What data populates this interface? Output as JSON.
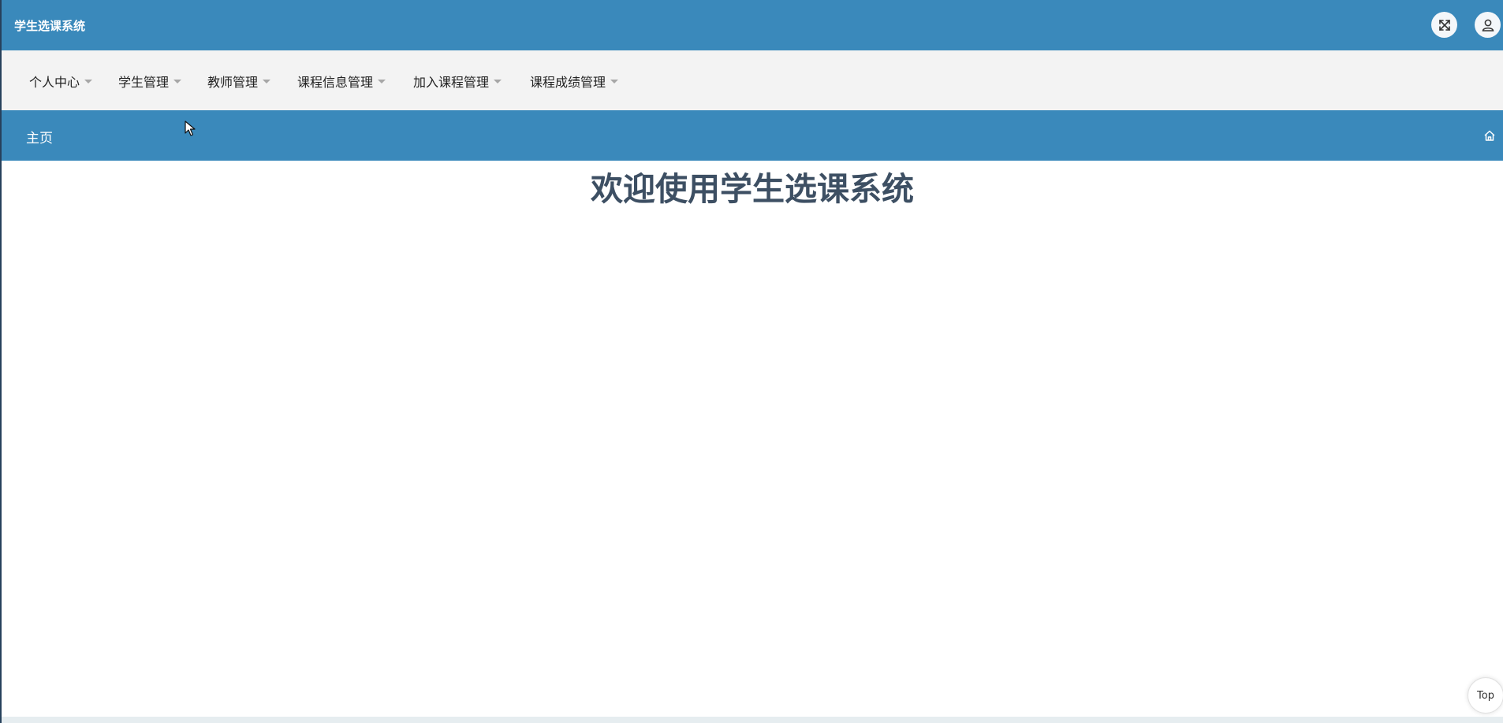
{
  "header": {
    "title": "学生选课系统",
    "fullscreen_icon": "fullscreen-icon",
    "user_icon": "user-icon",
    "background_color": "#3a89bb"
  },
  "nav": {
    "items": [
      {
        "label": "个人中心"
      },
      {
        "label": "学生管理"
      },
      {
        "label": "教师管理"
      },
      {
        "label": "课程信息管理"
      },
      {
        "label": "加入课程管理"
      },
      {
        "label": "课程成绩管理"
      }
    ]
  },
  "breadcrumb": {
    "label": "主页",
    "home_icon": "home-icon"
  },
  "main": {
    "welcome": "欢迎使用学生选课系统"
  },
  "back_to_top": {
    "label": "Top"
  }
}
